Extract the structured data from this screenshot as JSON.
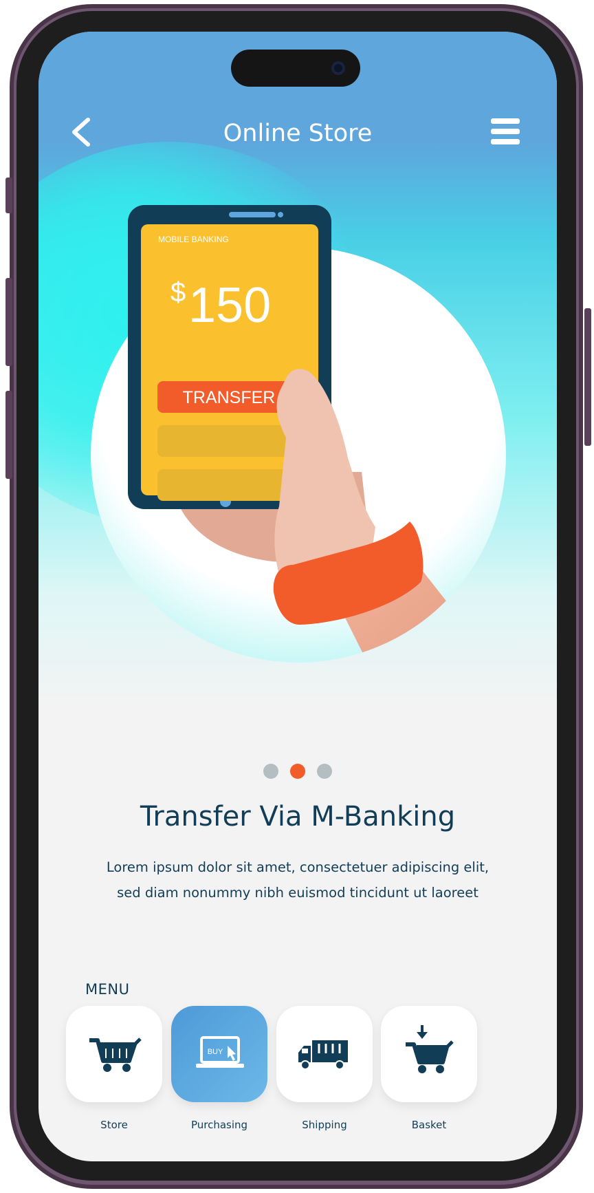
{
  "header": {
    "title": "Online Store",
    "back_icon": "chevron-left-icon",
    "menu_icon": "hamburger-menu-icon"
  },
  "illustration": {
    "phone_caption": "MOBILE BANKING",
    "currency": "$",
    "amount": "150",
    "button_label": "TRANSFER"
  },
  "pager": {
    "count": 3,
    "active_index": 1
  },
  "content": {
    "headline": "Transfer Via M-Banking",
    "description_line1": "Lorem ipsum dolor sit amet, consectetuer adipiscing elit,",
    "description_line2": "sed diam nonummy nibh euismod tincidunt ut laoreet"
  },
  "menu": {
    "label": "MENU",
    "items": [
      {
        "label": "Store",
        "icon": "shopping-cart-icon",
        "active": false
      },
      {
        "label": "Purchasing",
        "icon": "laptop-buy-icon",
        "active": true,
        "icon_text": "BUY"
      },
      {
        "label": "Shipping",
        "icon": "delivery-truck-icon",
        "active": false
      },
      {
        "label": "Basket",
        "icon": "basket-add-icon",
        "active": false
      }
    ]
  },
  "colors": {
    "header_blue": "#5ea6dc",
    "accent_orange": "#f25b2a",
    "phone_yellow": "#fbc02d",
    "text_navy": "#123d57",
    "active_tile": "#5aa8e0"
  }
}
